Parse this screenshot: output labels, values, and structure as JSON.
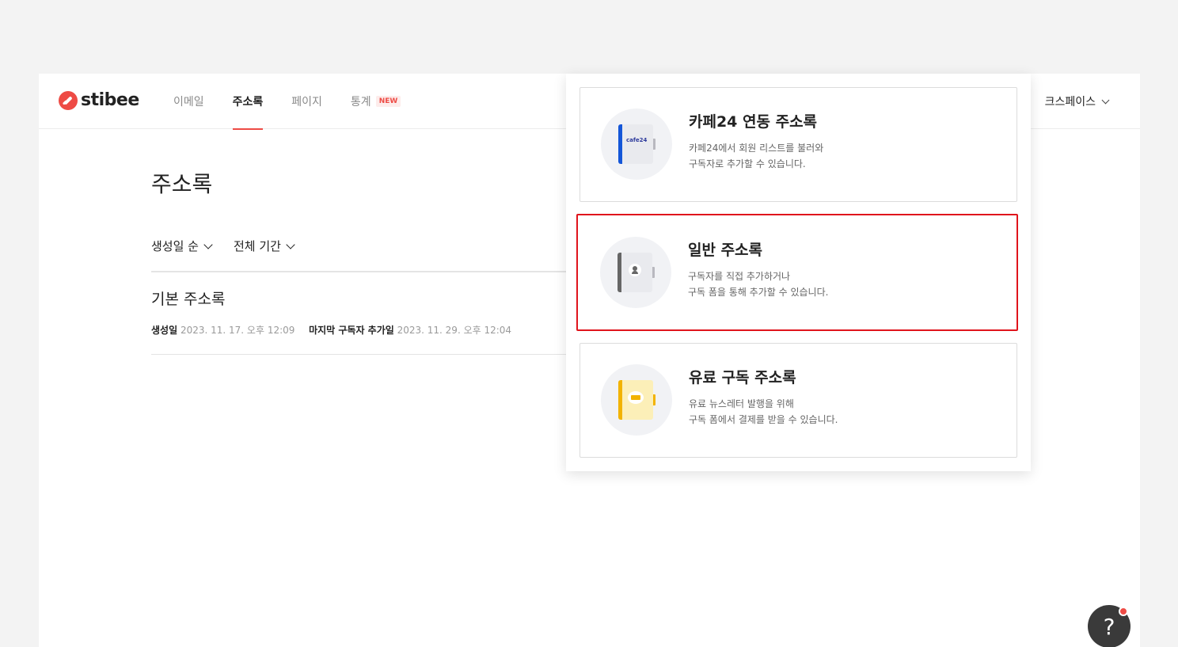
{
  "header": {
    "logo_text": "stibee",
    "nav": [
      {
        "label": "이메일",
        "active": false
      },
      {
        "label": "주소록",
        "active": true
      },
      {
        "label": "페이지",
        "active": false
      },
      {
        "label": "통계",
        "active": false,
        "badge": "NEW"
      }
    ],
    "workspace_label": "크스페이스"
  },
  "main": {
    "page_title": "주소록",
    "filters": [
      "생성일 순",
      "전체 기간"
    ],
    "list": [
      {
        "title": "기본 주소록",
        "created_label": "생성일",
        "created_value": "2023. 11. 17. 오후 12:09",
        "last_added_label": "마지막 구독자 추가일",
        "last_added_value": "2023. 11. 29. 오후 12:04"
      }
    ]
  },
  "dropdown": {
    "cards": [
      {
        "title": "카페24 연동 주소록",
        "desc_line1": "카페24에서 회원 리스트를 불러와",
        "desc_line2": "구독자로 추가할 수 있습니다.",
        "icon": "cafe24-book-icon",
        "icon_label": "cafe24",
        "spine_color": "#1456d8",
        "highlighted": false
      },
      {
        "title": "일반 주소록",
        "desc_line1": "구독자를 직접 추가하거나",
        "desc_line2": "구독 폼을 통해 추가할 수 있습니다.",
        "icon": "contact-book-icon",
        "spine_color": "#666666",
        "highlighted": true
      },
      {
        "title": "유료 구독 주소록",
        "desc_line1": "유료 뉴스레터 발행을 위해",
        "desc_line2": "구독 폼에서 결제를 받을 수 있습니다.",
        "icon": "paid-book-icon",
        "spine_color": "#f2b300",
        "highlighted": false
      }
    ]
  },
  "help": {
    "label": "?"
  },
  "colors": {
    "brand": "#ee4b45",
    "highlight": "#e0141c"
  }
}
